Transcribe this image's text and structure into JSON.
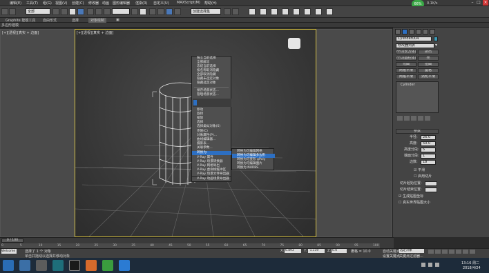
{
  "menubar": {
    "items": [
      "编辑(E)",
      "工具(T)",
      "组(G)",
      "视图(V)",
      "创建(C)",
      "修改器",
      "动画",
      "图形编辑器",
      "渲染(R)",
      "自定义(U)",
      "MAXScript(M)",
      "帮助(H)"
    ]
  },
  "toolbar": {
    "selection_filter": "全部",
    "named_selection": "创建选择集"
  },
  "ribbon": {
    "tabs": [
      "Graphite 建模工具",
      "自由形式",
      "选择",
      "对象绘制"
    ],
    "sub_tabs": [
      "多边形建模"
    ]
  },
  "viewport": {
    "label": "[+][透视][真实 + 边面]"
  },
  "quad_menu": {
    "top_items": [
      "独立当前选择",
      "全部解冻",
      "冻结当前选择",
      "按名称取消隐藏",
      "全部取消隐藏",
      "隐藏未选定对象",
      "隐藏选定对象",
      "保存场景状态...",
      "管理场景状态..."
    ],
    "mid_items": [
      "移动",
      "旋转",
      "缩放",
      "选择",
      "选择类似对象(S)",
      "克隆(C)",
      "对象属性(P)...",
      "曲线编辑器...",
      "摄影表...",
      "关联参数..."
    ],
    "convert_label": "转换为:",
    "vray_items": [
      "V-Ray 属性",
      "V-Ray 场景转换器",
      "V-Ray 网格导出",
      "V-Ray 虚拟帧缓冲区",
      "V-Ray 场景文件导出器",
      "V-Ray 动画场景导出器"
    ],
    "submenu": [
      "转换为可编辑网格",
      "转换为可编辑多边形",
      "转换为可变形 gPoly",
      "转换为可编辑面片",
      "转换为 NURBS"
    ]
  },
  "command_panel": {
    "object_name": "Cylinder004",
    "modifier_list": "修改器列表",
    "buttons": [
      [
        "FFD(长方体)",
        "挤出"
      ],
      [
        "FFD(圆柱体)",
        "壳"
      ],
      [
        "弯曲",
        "扭曲"
      ],
      [
        "网格平滑",
        "晶格"
      ],
      [
        "网格平滑",
        "涡轮平滑"
      ]
    ],
    "stack_item": "Cylinder",
    "rollout_title": "参数",
    "params": [
      {
        "label": "半径:",
        "value": "26.0"
      },
      {
        "label": "高度:",
        "value": "50.0"
      },
      {
        "label": "高度分段:",
        "value": "5"
      },
      {
        "label": "端面分段:",
        "value": "1"
      },
      {
        "label": "边数:",
        "value": "18"
      }
    ],
    "checkboxes": [
      "平滑",
      "启用切片",
      "生成贴图坐标",
      "真实世界贴图大小"
    ],
    "slice_from": "切片起始位置:",
    "slice_to": "切片结束位置:"
  },
  "timeline": {
    "frame_readout": "0 / 100",
    "ticks": [
      "0",
      "5",
      "10",
      "15",
      "20",
      "25",
      "30",
      "35",
      "40",
      "45",
      "50",
      "55",
      "60",
      "65",
      "70",
      "75",
      "80",
      "85",
      "90",
      "95",
      "100"
    ]
  },
  "status": {
    "selected": "选择了 1 个 对象",
    "hint": "单击并拖动以选择并移动对象",
    "x_label": "X:",
    "x_value": "6.893",
    "y_label": "Y:",
    "y_value": "-1.119",
    "z_label": "Z:",
    "z_value": "0.0",
    "grid": "栅格 = 10.0",
    "auto_key": "自动关键点",
    "set_key": "设置关键点",
    "key_filter": "关键点过滤器...",
    "selected_obj": "选定对象",
    "maxscript": "Welcome"
  },
  "clock": {
    "time": "13:16 周二",
    "date": "2018/4/24"
  },
  "badge": {
    "value": "66%",
    "net": "0.1K/s"
  }
}
